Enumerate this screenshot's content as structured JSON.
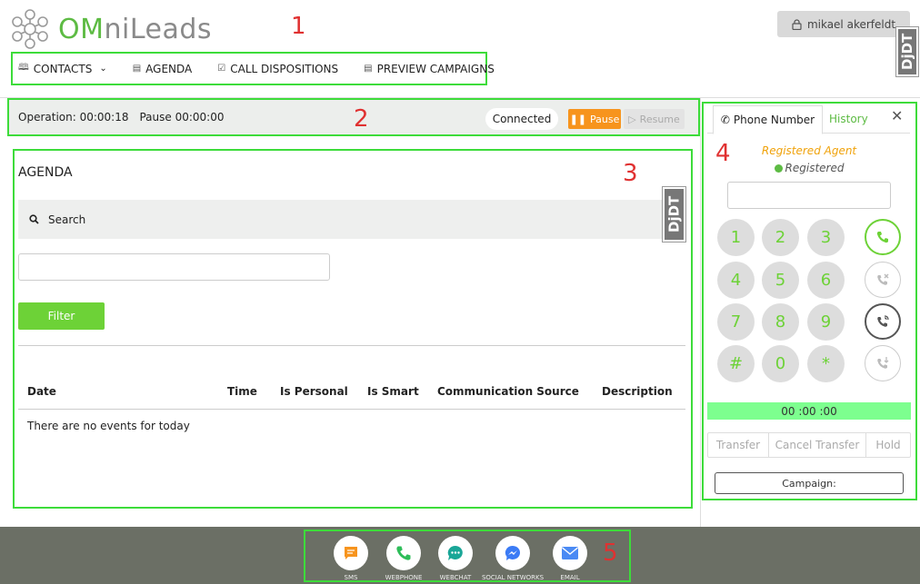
{
  "app": {
    "logo_text_a": "OM",
    "logo_text_b": "niLeads"
  },
  "header": {
    "user_name": "mikael akerfeldt",
    "debug_tab": "DjDT",
    "nav": [
      {
        "label": "CONTACTS",
        "icon": "book-icon",
        "has_dropdown": true
      },
      {
        "label": "AGENDA",
        "icon": "calendar-icon"
      },
      {
        "label": "CALL DISPOSITIONS",
        "icon": "checklist-icon"
      },
      {
        "label": "PREVIEW CAMPAIGNS",
        "icon": "document-icon"
      }
    ]
  },
  "annotations": [
    "1",
    "2",
    "3",
    "4",
    "5"
  ],
  "status_bar": {
    "operation": "Operation: 00:00:18",
    "pause_time": "Pause 00:00:00",
    "connection": "Connected",
    "pause_label": "Pause",
    "resume_label": "Resume"
  },
  "agenda": {
    "title": "AGENDA",
    "search_label": "Search",
    "search_value": "",
    "filter_label": "Filter",
    "columns": [
      "Date",
      "Time",
      "Is Personal",
      "Is Smart",
      "Communication Source",
      "Description"
    ],
    "empty_message": "There are no events for today",
    "debug_tab": "DjDT"
  },
  "phone_panel": {
    "tab_phone": "Phone Number",
    "tab_history": "History",
    "agent_title": "Registered Agent",
    "agent_status": "Registered",
    "dial_value": "",
    "keys": [
      "1",
      "2",
      "3",
      "4",
      "5",
      "6",
      "7",
      "8",
      "9",
      "#",
      "0",
      "*"
    ],
    "timer": "00 :00 :00",
    "transfer": "Transfer",
    "cancel_transfer": "Cancel Transfer",
    "hold": "Hold",
    "campaign": "Campaign:",
    "colors": {
      "accent": "#6dd237",
      "agent": "#f0a20a",
      "timer_bg": "#7dff8f"
    }
  },
  "dock": [
    {
      "label": "SMS",
      "icon": "sms-icon",
      "color": "#f7941d"
    },
    {
      "label": "WEBPHONE",
      "icon": "phone-icon",
      "color": "#2ebd59"
    },
    {
      "label": "WEBCHAT",
      "icon": "chat-icon",
      "color": "#19a697"
    },
    {
      "label": "SOCIAL NETWORKS",
      "icon": "messenger-icon",
      "color": "#3b7bf5"
    },
    {
      "label": "EMAIL",
      "icon": "email-icon",
      "color": "#4a8af4"
    }
  ]
}
